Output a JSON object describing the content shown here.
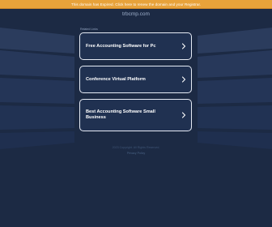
{
  "colors": {
    "background": "#1c2a44",
    "banner": "#e8a23a",
    "card_border": "#e6ebf5",
    "card_fill": "#203151"
  },
  "banner": {
    "text": "This domain has Expired. Click here to renew the domain and your Registrar."
  },
  "domain": "trbcmp.com",
  "related_searches_label": "Related Links",
  "links": [
    {
      "label": "Free Accounting Software for Pc",
      "icon": "chevron-right-icon"
    },
    {
      "label": "Conference Virtual Platform",
      "icon": "chevron-right-icon"
    },
    {
      "label": "Best Accounting Software Small Business",
      "icon": "chevron-right-icon"
    }
  ],
  "footer": {
    "line1": "2023 Copyright. All Rights Reserved.",
    "line2": "Privacy Policy"
  }
}
